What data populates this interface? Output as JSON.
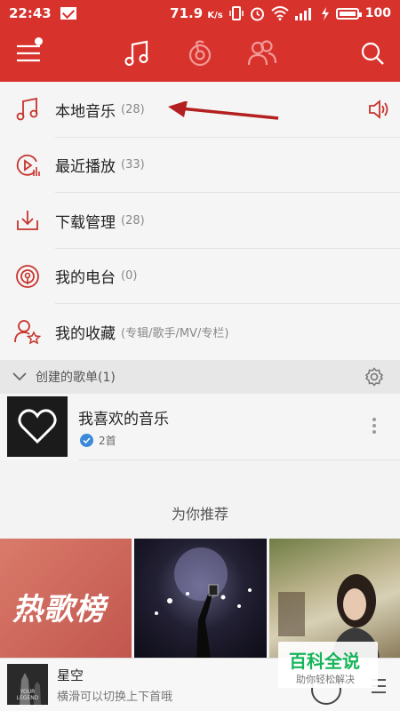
{
  "status": {
    "time": "22:43",
    "speed": "71.9",
    "speed_unit": "K/s",
    "battery": "100"
  },
  "header": {
    "icons": [
      "menu-icon",
      "music-note-icon",
      "radio-wave-icon",
      "friends-icon",
      "search-icon"
    ]
  },
  "list": [
    {
      "label": "本地音乐",
      "count": "(28)",
      "icon": "music-note-icon"
    },
    {
      "label": "最近播放",
      "count": "(33)",
      "icon": "recent-play-icon"
    },
    {
      "label": "下载管理",
      "count": "(28)",
      "icon": "download-icon"
    },
    {
      "label": "我的电台",
      "count": "(0)",
      "icon": "radio-icon"
    },
    {
      "label": "我的收藏",
      "count": "(专辑/歌手/MV/专栏)",
      "icon": "favorite-icon"
    }
  ],
  "section": {
    "title": "创建的歌单(1)"
  },
  "playlist": {
    "title": "我喜欢的音乐",
    "count": "2首"
  },
  "recommend": {
    "title": "为你推荐",
    "thumb1_text": "热歌榜"
  },
  "player": {
    "title": "星空",
    "subtitle": "横滑可以切换上下首哦",
    "cover_text": "YOUR LEGEND"
  },
  "watermark": {
    "title": "百科全说",
    "subtitle": "助你轻松解决"
  },
  "colors": {
    "brand": "#d8322d",
    "accent_blue": "#3b8ad9"
  }
}
